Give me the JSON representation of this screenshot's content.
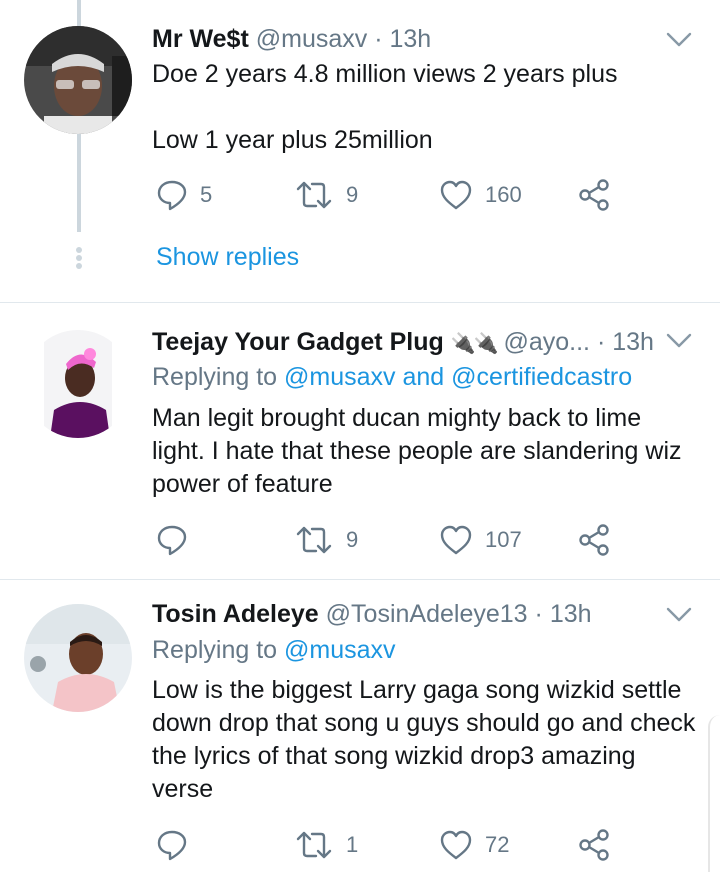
{
  "tweets": [
    {
      "name": "Mr We$t",
      "handle": "@musaxv",
      "separator": "·",
      "time": "13h",
      "body_lines": [
        "Doe 2 years 4.8 million views 2 years plus",
        "",
        "Low 1 year plus 25million"
      ],
      "reply_count": "5",
      "retweet_count": "9",
      "like_count": "160",
      "show_replies": "Show replies"
    },
    {
      "name": "Teejay Your Gadget Plug",
      "name_emoji": "🔌🔌",
      "handle": "@ayo...",
      "separator": "·",
      "time": "13h",
      "replying_label": "Replying to",
      "replying_users": [
        "@musaxv",
        "@certifiedcastro"
      ],
      "replying_and": "and",
      "body": "Man legit brought ducan mighty back to lime light. I hate that these people are slandering wiz power of feature",
      "reply_count": "",
      "retweet_count": "9",
      "like_count": "107"
    },
    {
      "name": "Tosin Adeleye",
      "handle": "@TosinAdeleye13",
      "separator": "·",
      "time": "13h",
      "replying_label": "Replying to",
      "replying_users": [
        "@musaxv"
      ],
      "body": "Low is the biggest Larry gaga song wizkid settle down drop that song u guys should go and check the lyrics of that song wizkid drop3 amazing verse",
      "reply_count": "",
      "retweet_count": "1",
      "like_count": "72"
    }
  ],
  "colors": {
    "text": "#14171a",
    "secondary": "#657786",
    "link": "#1b95e0",
    "divider": "#e1e8ed",
    "thread": "#ccd6dd"
  },
  "icons": [
    "reply-icon",
    "retweet-icon",
    "like-icon",
    "share-icon",
    "chevron-down-icon",
    "plug-emoji-icon"
  ]
}
